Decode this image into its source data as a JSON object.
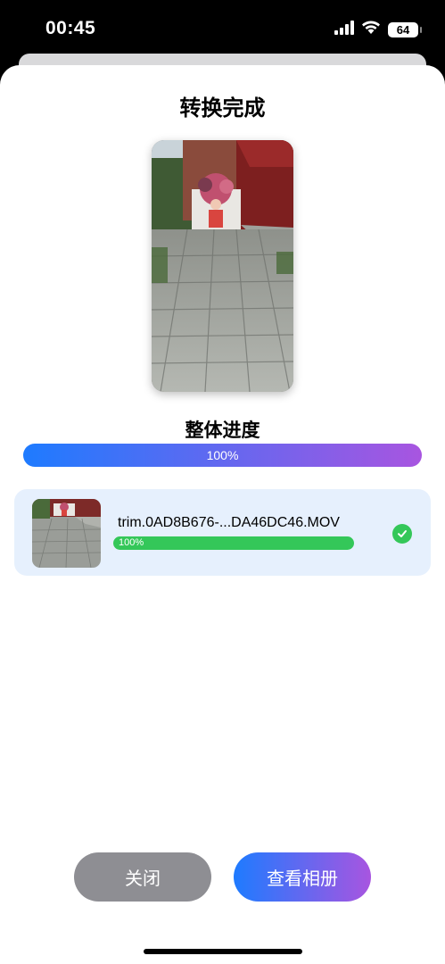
{
  "status_bar": {
    "time": "00:45",
    "battery": "64",
    "icons": [
      "signal-icon",
      "wifi-icon",
      "battery-icon"
    ]
  },
  "dialog": {
    "title": "转换完成",
    "preview_icon": "video-preview-image"
  },
  "overall_progress": {
    "label": "整体进度",
    "value": 100,
    "text": "100%"
  },
  "files": [
    {
      "name": "trim.0AD8B676-...DA46DC46.MOV",
      "progress": 100,
      "progress_text": "100%",
      "status_icon": "check-circle-icon"
    }
  ],
  "buttons": {
    "close": "关闭",
    "view_album": "查看相册"
  },
  "colors": {
    "accent_gradient_start": "#1e7bff",
    "accent_gradient_end": "#a855e0",
    "success": "#34c759",
    "card_background": "#e6f0fd",
    "close_button": "#8e8e93"
  }
}
